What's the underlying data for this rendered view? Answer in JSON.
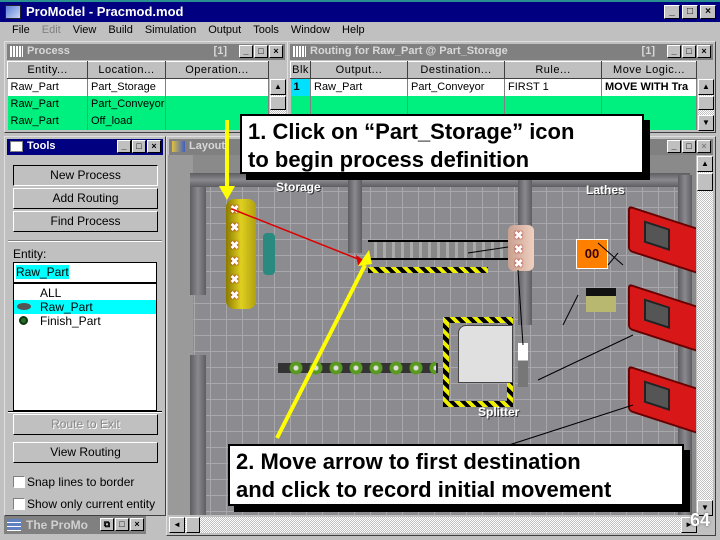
{
  "app": {
    "title": "ProModel - Pracmod.mod",
    "window_buttons": [
      "_",
      "□",
      "×"
    ]
  },
  "menu": [
    {
      "label": "File",
      "enabled": true
    },
    {
      "label": "Edit",
      "enabled": false
    },
    {
      "label": "View",
      "enabled": true
    },
    {
      "label": "Build",
      "enabled": true
    },
    {
      "label": "Simulation",
      "enabled": true
    },
    {
      "label": "Output",
      "enabled": true
    },
    {
      "label": "Tools",
      "enabled": true
    },
    {
      "label": "Window",
      "enabled": true
    },
    {
      "label": "Help",
      "enabled": true
    }
  ],
  "process_window": {
    "title": "Process",
    "record": "[1]",
    "columns": [
      "Entity...",
      "Location...",
      "Operation..."
    ],
    "rows": [
      {
        "entity": "Raw_Part",
        "location": "Part_Storage",
        "operation": "",
        "selected": true
      },
      {
        "entity": "Raw_Part",
        "location": "Part_Conveyor",
        "operation": ""
      },
      {
        "entity": "Raw_Part",
        "location": "Off_load",
        "operation": ""
      }
    ]
  },
  "routing_window": {
    "title": "Routing for Raw_Part @ Part_Storage",
    "record": "[1]",
    "columns": [
      "Blk",
      "Output...",
      "Destination...",
      "Rule...",
      "Move Logic..."
    ],
    "rows": [
      {
        "blk": "1",
        "output": "Raw_Part",
        "destination": "Part_Conveyor",
        "rule": "FIRST 1",
        "move_logic": "MOVE WITH Tra"
      }
    ]
  },
  "tools_window": {
    "title": "Tools",
    "buttons": {
      "new_process": "New Process",
      "add_routing": "Add Routing",
      "find_process": "Find Process",
      "route_to_exit": "Route to Exit",
      "view_routing": "View Routing"
    },
    "entity_label": "Entity:",
    "entity_value": "Raw_Part",
    "entity_list": [
      {
        "label": "ALL",
        "icon": ""
      },
      {
        "label": "Raw_Part",
        "icon": "raw-part-icon",
        "selected": true
      },
      {
        "label": "Finish_Part",
        "icon": "finish-part-icon"
      }
    ],
    "checkboxes": [
      {
        "label": "Snap lines to border",
        "checked": false
      },
      {
        "label": "Show only current entity",
        "checked": false
      }
    ]
  },
  "minimized_window": {
    "title": "The ProMo"
  },
  "layout_window": {
    "title": "Layout",
    "location_labels": {
      "storage": "Storage",
      "lathes": "Lathes",
      "splitter": "Splitter"
    },
    "counter_value": "00"
  },
  "callouts": {
    "step1_line1": "1.  Click on “Part_Storage” icon",
    "step1_line2": "to begin process definition",
    "step2_line1": "2.  Move arrow to first destination",
    "step2_line2": "and click to record initial movement"
  },
  "slide_number": "64",
  "colors": {
    "title_active": "#000080",
    "row_green": "#00f080",
    "selection_cyan": "#00ffff",
    "pointer_arrow": "#ffff00",
    "route_line": "#dd0000"
  }
}
